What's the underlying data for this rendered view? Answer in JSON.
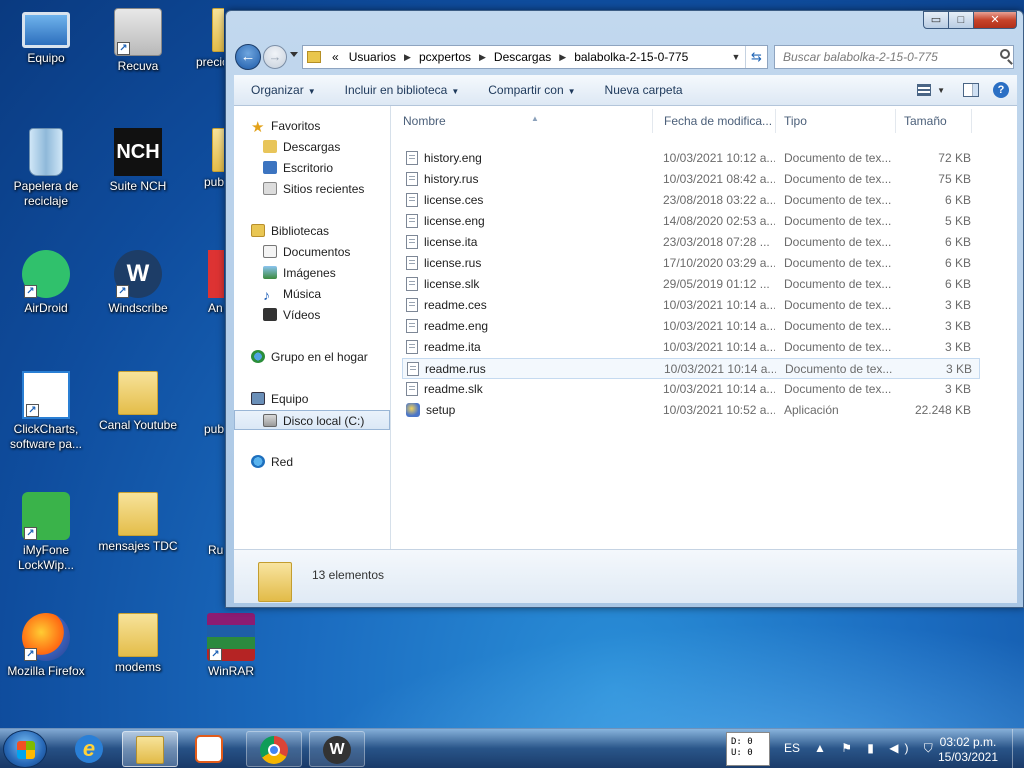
{
  "desktop": {
    "icons": [
      {
        "label": "Equipo",
        "icon": "computer-icon"
      },
      {
        "label": "Recuva",
        "icon": "recuva-icon"
      },
      {
        "label": "precio",
        "icon": "folder-icon"
      },
      {
        "label": "Papelera de reciclaje",
        "icon": "recycle-bin-icon"
      },
      {
        "label": "Suite NCH",
        "icon": "nch-icon"
      },
      {
        "label": "pub",
        "icon": "folder-icon"
      },
      {
        "label": "AirDroid",
        "icon": "airdroid-icon"
      },
      {
        "label": "Windscribe",
        "icon": "windscribe-icon"
      },
      {
        "label": "An",
        "icon": "app-icon"
      },
      {
        "label": "ClickCharts, software pa...",
        "icon": "clickcharts-icon"
      },
      {
        "label": "Canal Youtube",
        "icon": "folder-icon"
      },
      {
        "label": "pub",
        "icon": "archive-icon"
      },
      {
        "label": "iMyFone LockWip...",
        "icon": "imyfone-icon"
      },
      {
        "label": "mensajes TDC",
        "icon": "folder-icon"
      },
      {
        "label": "Ru",
        "icon": "app-icon"
      },
      {
        "label": "Mozilla Firefox",
        "icon": "firefox-icon"
      },
      {
        "label": "modems",
        "icon": "folder-icon"
      },
      {
        "label": "WinRAR",
        "icon": "winrar-icon"
      }
    ]
  },
  "window": {
    "controls": {
      "minimize": "▭",
      "maximize": "□",
      "close": "✕"
    },
    "address": {
      "prefix": "«",
      "segments": [
        "Usuarios",
        "pcxpertos",
        "Descargas",
        "balabolka-2-15-0-775"
      ]
    },
    "search": {
      "placeholder": "Buscar balabolka-2-15-0-775"
    },
    "toolbar": {
      "organize": "Organizar",
      "include": "Incluir en biblioteca",
      "share": "Compartir con",
      "new_folder": "Nueva carpeta"
    },
    "nav": {
      "favorites": "Favoritos",
      "downloads": "Descargas",
      "desktop": "Escritorio",
      "recent": "Sitios recientes",
      "libraries": "Bibliotecas",
      "documents": "Documentos",
      "images": "Imágenes",
      "music": "Música",
      "videos": "Vídeos",
      "homegroup": "Grupo en el hogar",
      "computer": "Equipo",
      "local_disk": "Disco local (C:)",
      "network": "Red"
    },
    "columns": {
      "name": "Nombre",
      "date": "Fecha de modifica...",
      "type": "Tipo",
      "size": "Tamaño"
    },
    "files": [
      {
        "name": "history.eng",
        "date": "10/03/2021 10:12 a...",
        "type": "Documento de tex...",
        "size": "72 KB"
      },
      {
        "name": "history.rus",
        "date": "10/03/2021 08:42 a...",
        "type": "Documento de tex...",
        "size": "75 KB"
      },
      {
        "name": "license.ces",
        "date": "23/08/2018 03:22 a...",
        "type": "Documento de tex...",
        "size": "6 KB"
      },
      {
        "name": "license.eng",
        "date": "14/08/2020 02:53 a...",
        "type": "Documento de tex...",
        "size": "5 KB"
      },
      {
        "name": "license.ita",
        "date": "23/03/2018 07:28 ...",
        "type": "Documento de tex...",
        "size": "6 KB"
      },
      {
        "name": "license.rus",
        "date": "17/10/2020 03:29 a...",
        "type": "Documento de tex...",
        "size": "6 KB"
      },
      {
        "name": "license.slk",
        "date": "29/05/2019 01:12 ...",
        "type": "Documento de tex...",
        "size": "6 KB"
      },
      {
        "name": "readme.ces",
        "date": "10/03/2021 10:14 a...",
        "type": "Documento de tex...",
        "size": "3 KB"
      },
      {
        "name": "readme.eng",
        "date": "10/03/2021 10:14 a...",
        "type": "Documento de tex...",
        "size": "3 KB"
      },
      {
        "name": "readme.ita",
        "date": "10/03/2021 10:14 a...",
        "type": "Documento de tex...",
        "size": "3 KB"
      },
      {
        "name": "readme.rus",
        "date": "10/03/2021 10:14 a...",
        "type": "Documento de tex...",
        "size": "3 KB"
      },
      {
        "name": "readme.slk",
        "date": "10/03/2021 10:14 a...",
        "type": "Documento de tex...",
        "size": "3 KB"
      },
      {
        "name": "setup",
        "date": "10/03/2021 10:52 a...",
        "type": "Aplicación",
        "size": "22.248 KB"
      }
    ],
    "status": {
      "count": "13 elementos"
    }
  },
  "taskbar": {
    "drive_widget": {
      "line1": "D: 0",
      "line2": "U: 0"
    },
    "language": "ES",
    "tray": "▲ ⚑ ▮ ◀) ⛉",
    "clock": {
      "time": "03:02 p.m.",
      "date": "15/03/2021"
    }
  }
}
